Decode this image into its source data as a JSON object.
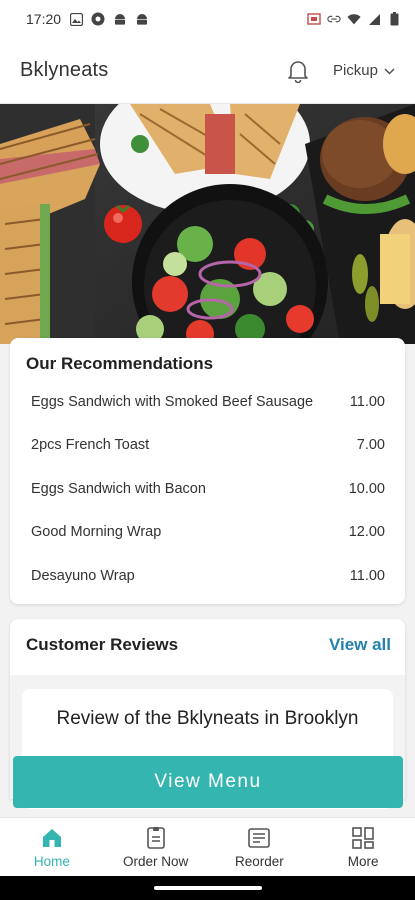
{
  "status_bar": {
    "time": "17:20"
  },
  "header": {
    "title": "Bklyneats",
    "pickup_label": "Pickup"
  },
  "recommendations": {
    "title": "Our Recommendations",
    "items": [
      {
        "name": "Eggs Sandwich with Smoked Beef Sausage",
        "price": "11.00"
      },
      {
        "name": "2pcs French Toast",
        "price": "7.00"
      },
      {
        "name": "Eggs Sandwich with Bacon",
        "price": "10.00"
      },
      {
        "name": "Good Morning Wrap",
        "price": "12.00"
      },
      {
        "name": "Desayuno Wrap",
        "price": "11.00"
      }
    ]
  },
  "reviews": {
    "title": "Customer Reviews",
    "view_all_label": "View all",
    "review_heading": "Review of the Bklyneats in Brooklyn"
  },
  "cta": {
    "label": "View Menu"
  },
  "bottom_nav": {
    "items": [
      {
        "label": "Home",
        "icon": "home-icon",
        "active": true
      },
      {
        "label": "Order Now",
        "icon": "order-icon",
        "active": false
      },
      {
        "label": "Reorder",
        "icon": "reorder-icon",
        "active": false
      },
      {
        "label": "More",
        "icon": "more-grid-icon",
        "active": false
      }
    ]
  },
  "colors": {
    "accent": "#35b5b0",
    "link": "#2383ab"
  }
}
